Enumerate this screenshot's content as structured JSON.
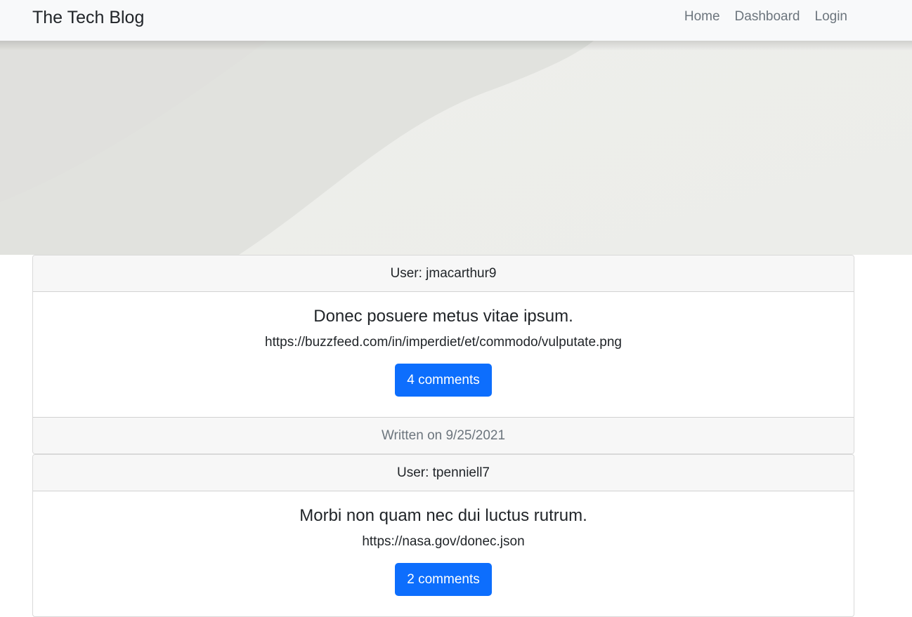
{
  "navbar": {
    "brand": "The Tech Blog",
    "links": [
      "Home",
      "Dashboard",
      "Login"
    ]
  },
  "posts": [
    {
      "user_label": "User: jmacarthur9",
      "title": "Donec posuere metus vitae ipsum.",
      "text": "https://buzzfeed.com/in/imperdiet/et/commodo/vulputate.png",
      "comments_label": "4 comments",
      "footer": "Written on 9/25/2021"
    },
    {
      "user_label": "User: tpenniell7",
      "title": "Morbi non quam nec dui luctus rutrum.",
      "text": "https://nasa.gov/donec.json",
      "comments_label": "2 comments"
    }
  ],
  "colors": {
    "navbar_bg": "#f8f9fa",
    "accent": "#0d6efd",
    "card_header_bg": "#f7f7f7",
    "muted_text": "#6c757d"
  }
}
